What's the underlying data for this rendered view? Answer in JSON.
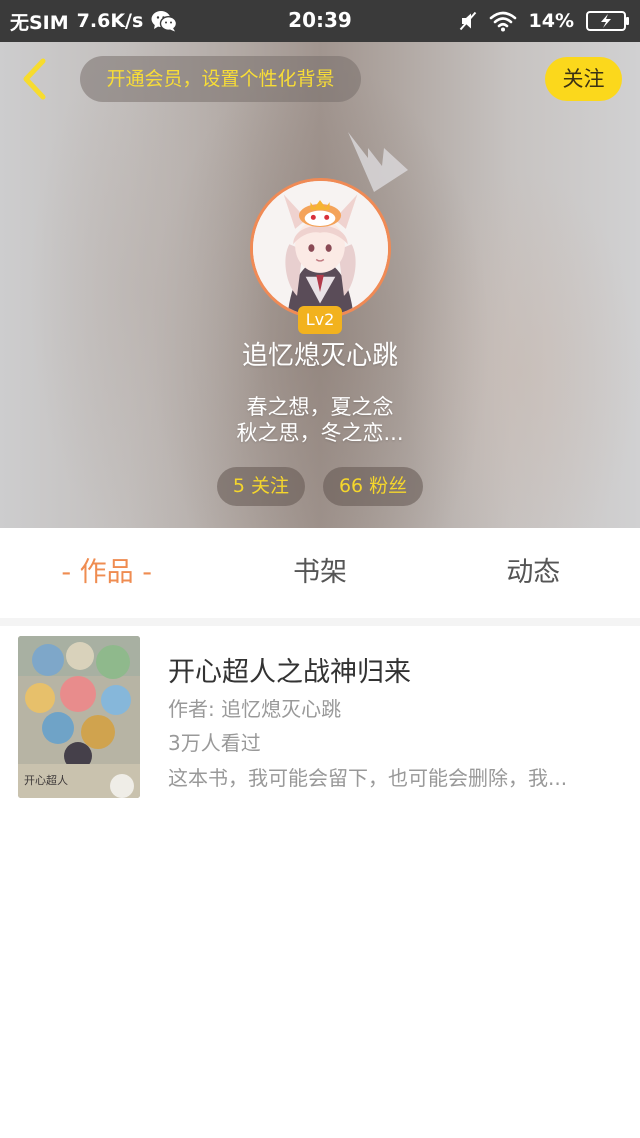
{
  "status_bar": {
    "carrier": "无SIM",
    "net_speed": "7.6K/s",
    "notification_icon": "wechat-icon",
    "time": "20:39",
    "icons": [
      "mute-icon",
      "wifi-icon",
      "battery-charging-icon"
    ],
    "battery": "14%"
  },
  "header": {
    "back_icon": "back-arrow-icon",
    "vip_banner": "开通会员，设置个性化背景",
    "follow_label": "关注"
  },
  "profile": {
    "level": "Lv2",
    "username": "追忆熄灭心跳",
    "bio_line1": "春之想，夏之念",
    "bio_line2": "秋之思，冬之恋...",
    "following": "5 关注",
    "followers": "66 粉丝"
  },
  "tabs": [
    {
      "label": "- 作品 -",
      "active": true
    },
    {
      "label": "书架",
      "active": false
    },
    {
      "label": "动态",
      "active": false
    }
  ],
  "works": [
    {
      "title": "开心超人之战神归来",
      "author": "作者: 追忆熄灭心跳",
      "views": "3万人看过",
      "description": "这本书，我可能会留下，也可能会删除，我..."
    }
  ],
  "colors": {
    "accent": "#ef8c51",
    "follow_bg": "#fbd81c",
    "level_badge": "#f2b21e",
    "stat_text": "#f5d62c",
    "avatar_ring": "#f08a55"
  }
}
